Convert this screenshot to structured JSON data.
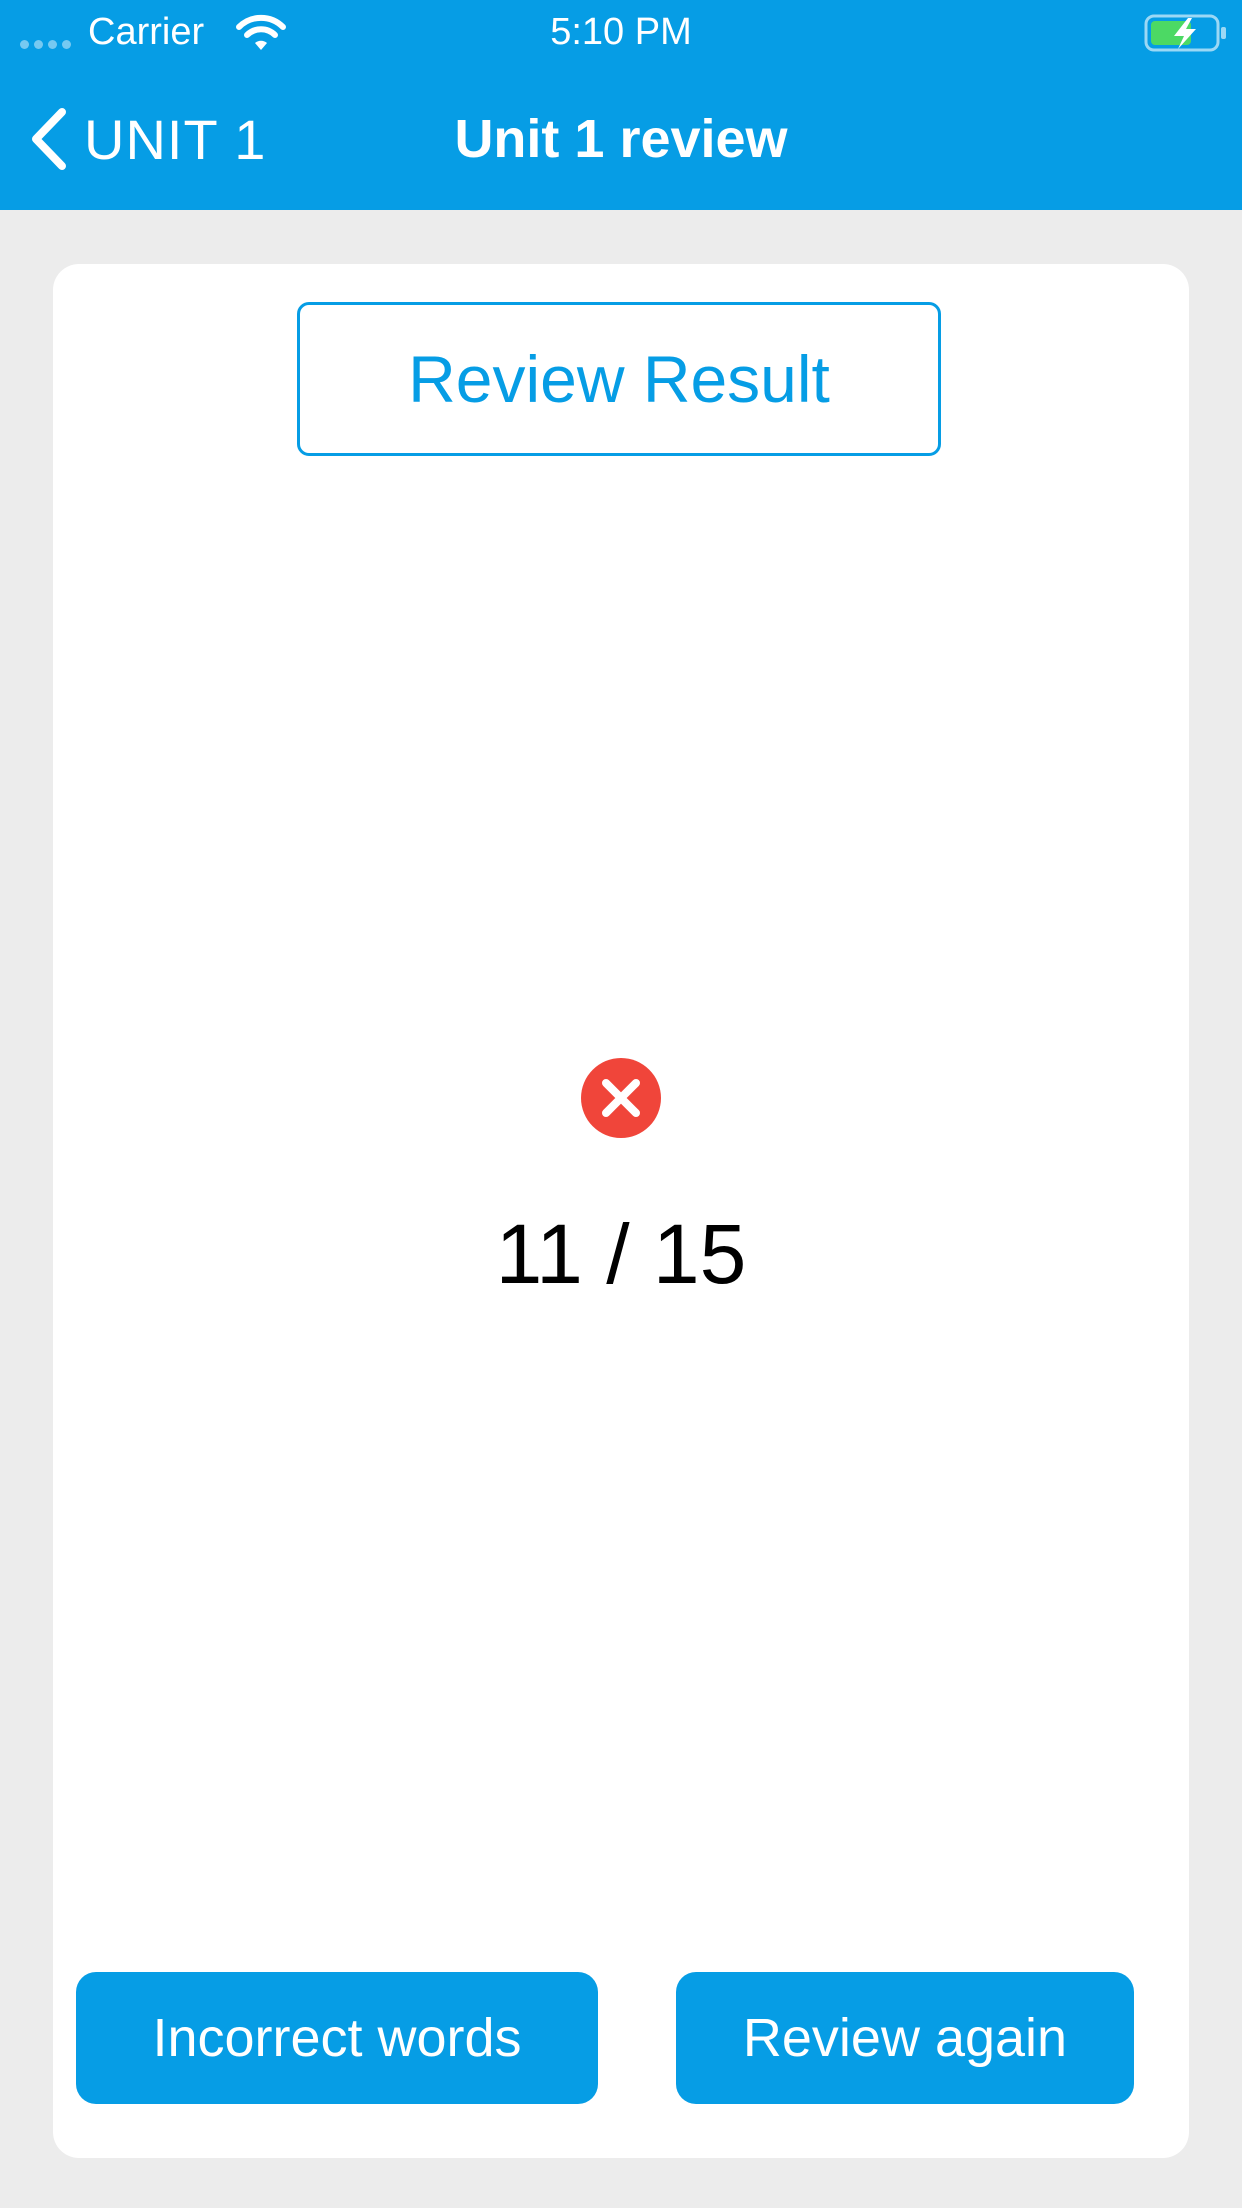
{
  "status_bar": {
    "carrier": "Carrier",
    "time": "5:10 PM",
    "signal_icon": "signal-dots-icon",
    "wifi_icon": "wifi-icon",
    "battery_icon": "battery-charging-icon"
  },
  "nav": {
    "back_label": "UNIT 1",
    "back_icon": "chevron-left-icon",
    "title": "Unit 1 review"
  },
  "card": {
    "result_heading": "Review Result",
    "status_icon": "close-circle-icon",
    "score": "11 / 15"
  },
  "actions": {
    "incorrect_words_label": "Incorrect words",
    "review_again_label": "Review again"
  },
  "colors": {
    "accent": "#069de5",
    "background": "#ececec",
    "error": "#f0453a",
    "battery_fill": "#4cd964"
  }
}
